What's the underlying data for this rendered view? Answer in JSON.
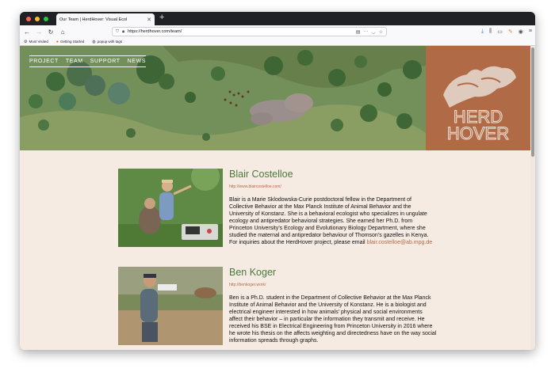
{
  "browser": {
    "tab_title": "Our Team | HerdHover: Visual Ecol",
    "tab_close": "✕",
    "new_tab": "+",
    "url": "https://herdhover.com/team/",
    "bookmarks": [
      "Most Visited",
      "Getting Started",
      "popup with tags"
    ]
  },
  "nav": {
    "items": [
      "PROJECT",
      "TEAM",
      "SUPPORT",
      "NEWS"
    ]
  },
  "logo": {
    "line1": "HERD",
    "line2": "HOVER"
  },
  "colors": {
    "accent": "#b06a46",
    "name_green": "#4a7a3a",
    "page_bg": "#f5ebe3"
  },
  "profiles": [
    {
      "name": "Blair Costelloe",
      "website": "http://www.blaircostelloe.com/",
      "bio": "Blair is a Marie Sklodowska-Curie postdoctoral fellow in the Department of Collective Behavior at the Max Planck Institute of Animal Behavior and the University of Konstanz. She is a behavioral ecologist who specializes in ungulate ecology and antipredator behavioral strategies. She earned her Ph.D. from Princeton University’s Ecology and Evolutionary Biology Department, where she studied the maternal and antipredator behaviour of Thomson’s gazelles in Kenya. For inquiries about the HerdHover project, please email",
      "email": "blair.costelloe@ab.mpg.de"
    },
    {
      "name": "Ben Koger",
      "website": "http://benkoger.work/",
      "bio": "Ben is a Ph.D. student in the Department of Collective Behavior at the Max Planck Institute of Animal Behavior and the University of Konstanz. He is a biologist and electrical engineer interested in how animals’ physical and social environments affect their behavior – in particular the information they transmit and receive. He received his BSE in Electrical Engineering from Princeton University in 2016 where he wrote his thesis on the affects weighting and directedness have on the way social information spreads through graphs."
    }
  ]
}
